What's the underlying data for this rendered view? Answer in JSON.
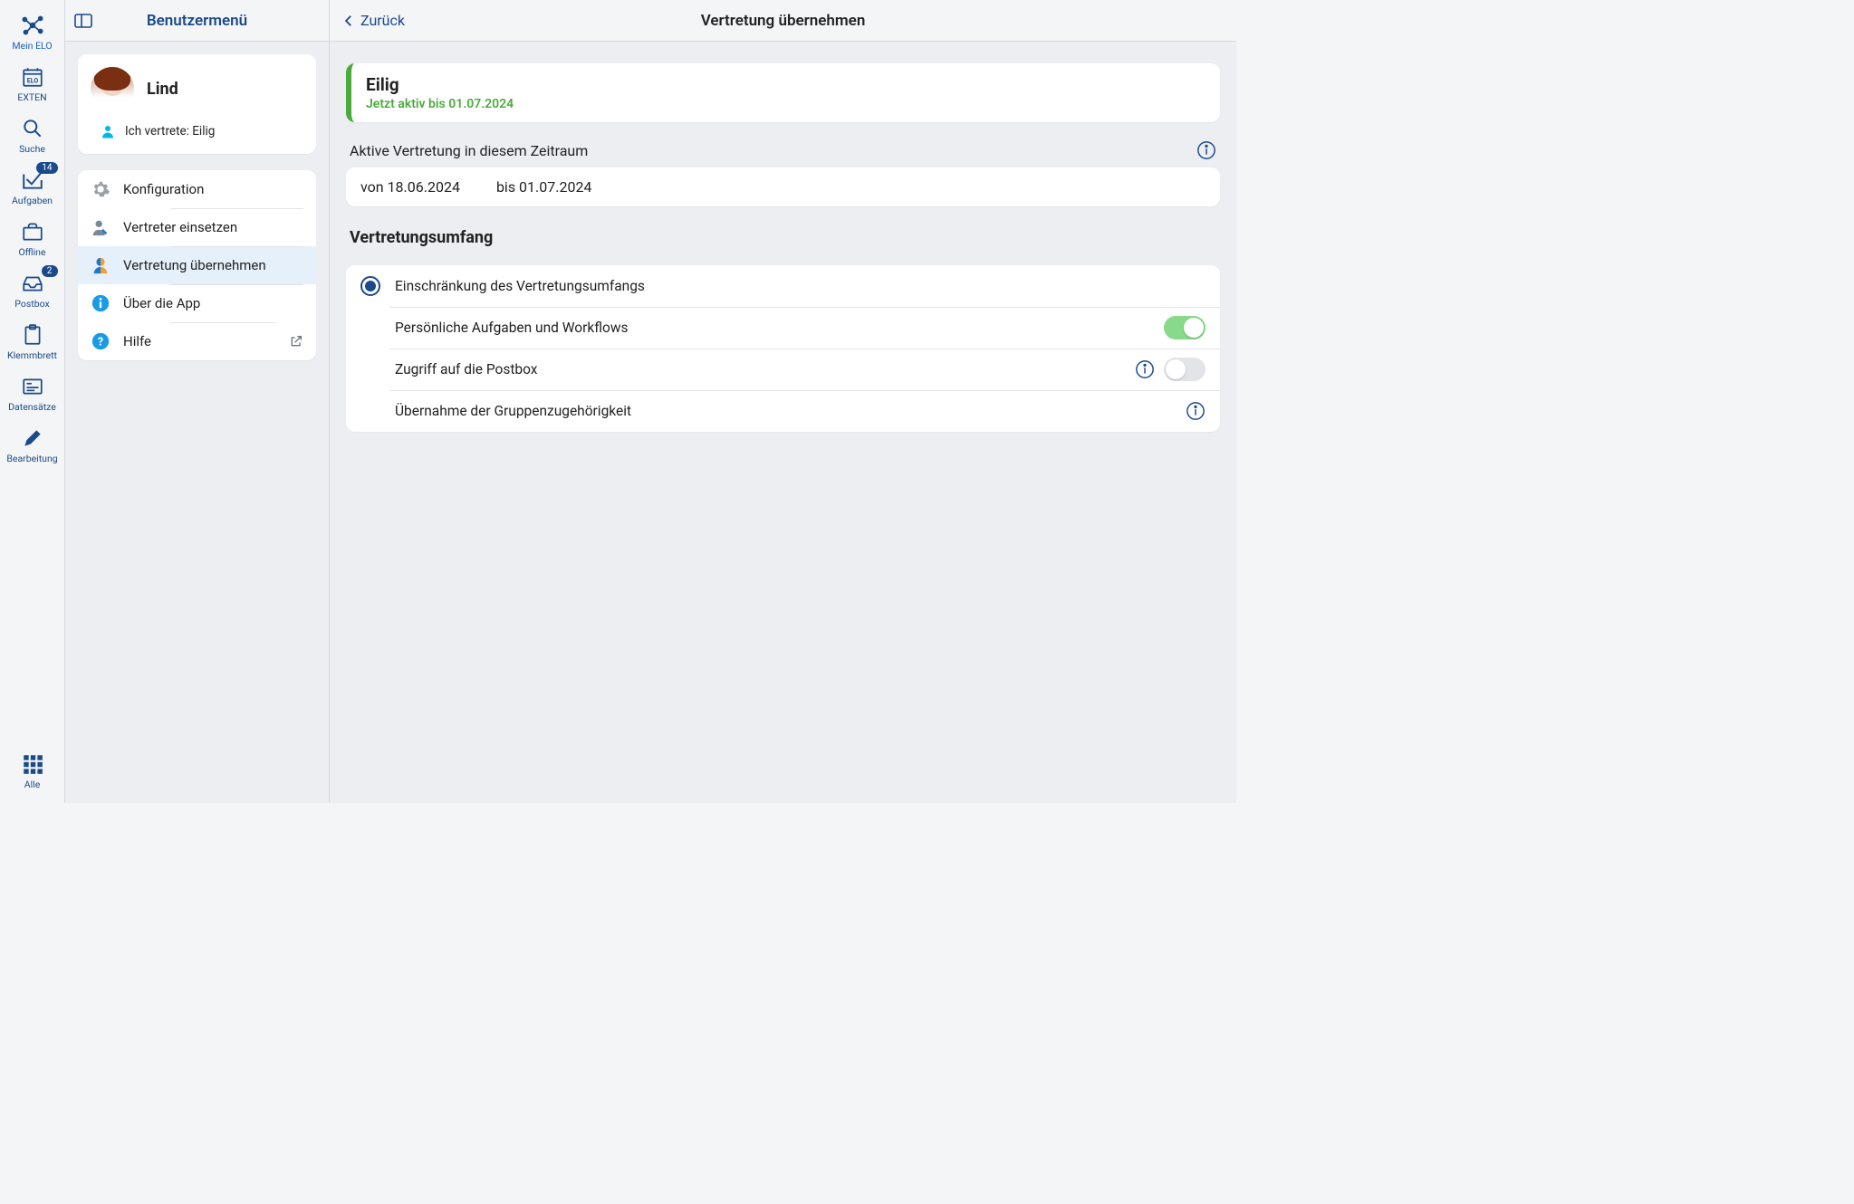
{
  "rail": {
    "items": [
      {
        "id": "mein-elo",
        "label": "Mein ELO"
      },
      {
        "id": "exten",
        "label": "EXTEN"
      },
      {
        "id": "suche",
        "label": "Suche"
      },
      {
        "id": "aufgaben",
        "label": "Aufgaben",
        "badge": "14"
      },
      {
        "id": "offline",
        "label": "Offline"
      },
      {
        "id": "postbox",
        "label": "Postbox",
        "badge": "2"
      },
      {
        "id": "klemmbrett",
        "label": "Klemmbrett"
      },
      {
        "id": "datensaetze",
        "label": "Datensätze"
      },
      {
        "id": "bearbeitung",
        "label": "Bearbeitung"
      }
    ],
    "bottom": {
      "id": "alle",
      "label": "Alle"
    }
  },
  "mid": {
    "title": "Benutzermenü",
    "user": {
      "name": "Lind",
      "rep_text": "Ich vertrete: Eilig"
    },
    "menu": [
      {
        "id": "config",
        "label": "Konfiguration",
        "icon": "gear"
      },
      {
        "id": "set-rep",
        "label": "Vertreter einsetzen",
        "icon": "user-wrench"
      },
      {
        "id": "take-rep",
        "label": "Vertretung übernehmen",
        "icon": "user-split",
        "selected": true
      },
      {
        "id": "about",
        "label": "Über die App",
        "icon": "info"
      },
      {
        "id": "help",
        "label": "Hilfe",
        "icon": "help",
        "external": true
      }
    ]
  },
  "detail": {
    "back_label": "Zurück",
    "title": "Vertretung übernehmen",
    "banner": {
      "title": "Eilig",
      "subtitle": "Jetzt aktiv bis 01.07.2024"
    },
    "period": {
      "heading": "Aktive Vertretung in diesem Zeitraum",
      "from_label": "von",
      "from_value": "18.06.2024",
      "to_label": "bis",
      "to_value": "01.07.2024"
    },
    "scope": {
      "heading": "Vertretungsumfang",
      "radio_label": "Einschränkung des Vertretungsumfangs",
      "radio_checked": true,
      "rows": [
        {
          "id": "tasks",
          "label": "Persönliche Aufgaben und Workflows",
          "switch": true,
          "info": false
        },
        {
          "id": "postbox",
          "label": "Zugriff auf die Postbox",
          "switch": false,
          "info": true
        },
        {
          "id": "groups",
          "label": "Übernahme der Gruppenzugehörigkeit",
          "switch": null,
          "info": true
        }
      ]
    }
  }
}
